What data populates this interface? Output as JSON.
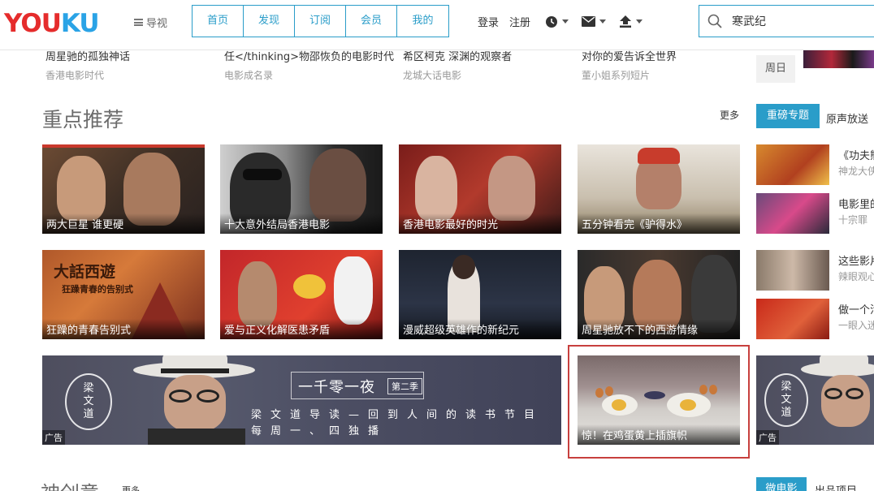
{
  "header": {
    "logo_left": "YOU",
    "logo_right": "KU",
    "guide": "导视",
    "nav_tabs": [
      "首页",
      "发现",
      "订阅",
      "会员",
      "我的"
    ],
    "login": "登录",
    "register": "注册",
    "search_value": "寒武纪"
  },
  "top_row": [
    {
      "title": "周星驰的孤独神话",
      "sub": "香港电影时代"
    },
    {
      "title": "任</thinking>物邵恢负的电影时代",
      "sub": "电影成名录"
    },
    {
      "title": "希区柯克 深渊的观察者",
      "sub": "龙城大话电影"
    },
    {
      "title": "对你的爱告诉全世界",
      "sub": "董小姐系列短片"
    }
  ],
  "day_filter": "周日",
  "section": {
    "title": "重点推荐",
    "more": "更多",
    "tab_active": "重磅专题",
    "tab_other": "原声放送"
  },
  "grid": [
    {
      "caption": "两大巨星 谁更硬"
    },
    {
      "caption": "十大意外结局香港电影"
    },
    {
      "caption": "香港电影最好的时光"
    },
    {
      "caption": "五分钟看完《驴得水》"
    },
    {
      "caption": "狂躁的青春告别式"
    },
    {
      "caption": "爱与正义化解医患矛盾"
    },
    {
      "caption": "漫威超级英雄作的新纪元"
    },
    {
      "caption": "周星驰放不下的西游情缘"
    }
  ],
  "sidebar": [
    {
      "title": "《功夫熊",
      "sub": "神龙大侠"
    },
    {
      "title": "电影里的",
      "sub": "十宗罪"
    },
    {
      "title": "这些影片",
      "sub": "辣眼观心"
    },
    {
      "title": "做一个污",
      "sub": "一眼入迷"
    }
  ],
  "thumb_poster_text": [
    "大話西遊",
    "狂躁青春的告别式"
  ],
  "ad_banner": {
    "badge": "广告",
    "seal": [
      "梁",
      "文",
      "道"
    ],
    "title": "一千零一夜",
    "season": "第二季",
    "line1": "梁文道导读—回到人间的读书节目",
    "line2": "每周一、四独播"
  },
  "highlight": {
    "caption": "惊！在鸡蛋黄上插旗帜"
  },
  "ad_right": {
    "badge": "广告",
    "seal": [
      "梁",
      "文",
      "道"
    ]
  },
  "bottom": {
    "title": "神创意",
    "more": "更多",
    "tab_active": "微电影",
    "tab_other": "出品项目"
  },
  "colors": {
    "brand_red": "#e52c2c",
    "brand_blue": "#2aa3e6",
    "accent": "#2a9dc9",
    "highlight_border": "#c8403e"
  }
}
